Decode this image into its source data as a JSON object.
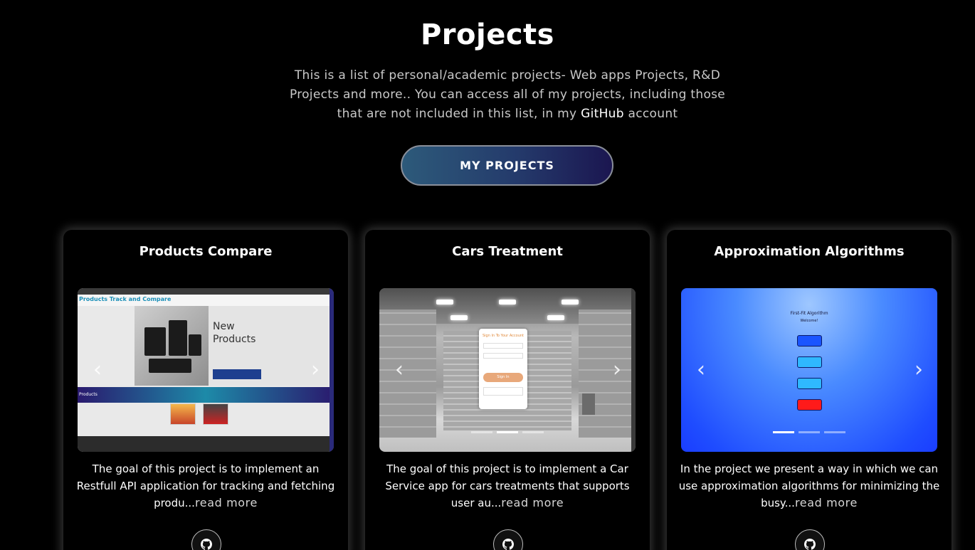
{
  "header": {
    "title": "Projects",
    "intro_before": "This is a list of personal/academic projects- Web apps Projects, R&D Projects and more.. You can access all of my projects, including those that are not included in this list, in my ",
    "intro_link": "GitHub",
    "intro_after": " account",
    "button_label": "MY PROJECTS"
  },
  "projects": [
    {
      "title": "Products Compare",
      "description": "The goal of this project is to implement an Restfull API application for tracking and fetching produ...",
      "more": "read more",
      "screenshot": {
        "brand": "Products Track and Compare",
        "hero_line1": "New",
        "hero_line2": "Products",
        "band_label": "Products"
      }
    },
    {
      "title": "Cars Treatment",
      "description": "The goal of this project is to implement a Car Service app for cars treatments that supports user au...",
      "more": "read more",
      "screenshot": {
        "form_title": "Sign In To Your Account",
        "sign_in": "Sign In"
      }
    },
    {
      "title": "Approximation Algorithms",
      "description": "In the project we present a way in which we can use approximation algorithms for minimizing the busy...",
      "more": "read more",
      "screenshot": {
        "heading": "First-Fit Algorithm",
        "welcome": "Welcome!"
      }
    }
  ],
  "icons": {
    "prev": "chevron-left-icon",
    "next": "chevron-right-icon",
    "github": "github-icon"
  },
  "colors": {
    "background": "#000000",
    "button_gradient_start": "#2d5a7a",
    "button_gradient_end": "#1b1650"
  }
}
